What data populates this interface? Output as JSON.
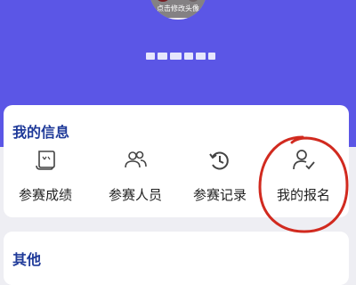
{
  "profile": {
    "avatar_caption": "点击修改头像"
  },
  "info_card": {
    "title": "我的信息",
    "items": [
      {
        "label": "参赛成绩",
        "icon": "certificate-icon"
      },
      {
        "label": "参赛人员",
        "icon": "people-icon"
      },
      {
        "label": "参赛记录",
        "icon": "history-icon"
      },
      {
        "label": "我的报名",
        "icon": "user-check-icon"
      }
    ]
  },
  "other_card": {
    "title": "其他"
  },
  "colors": {
    "header_bg": "#5b56e6",
    "title_color": "#1f3a99",
    "annotation_red": "#d12a1f"
  }
}
